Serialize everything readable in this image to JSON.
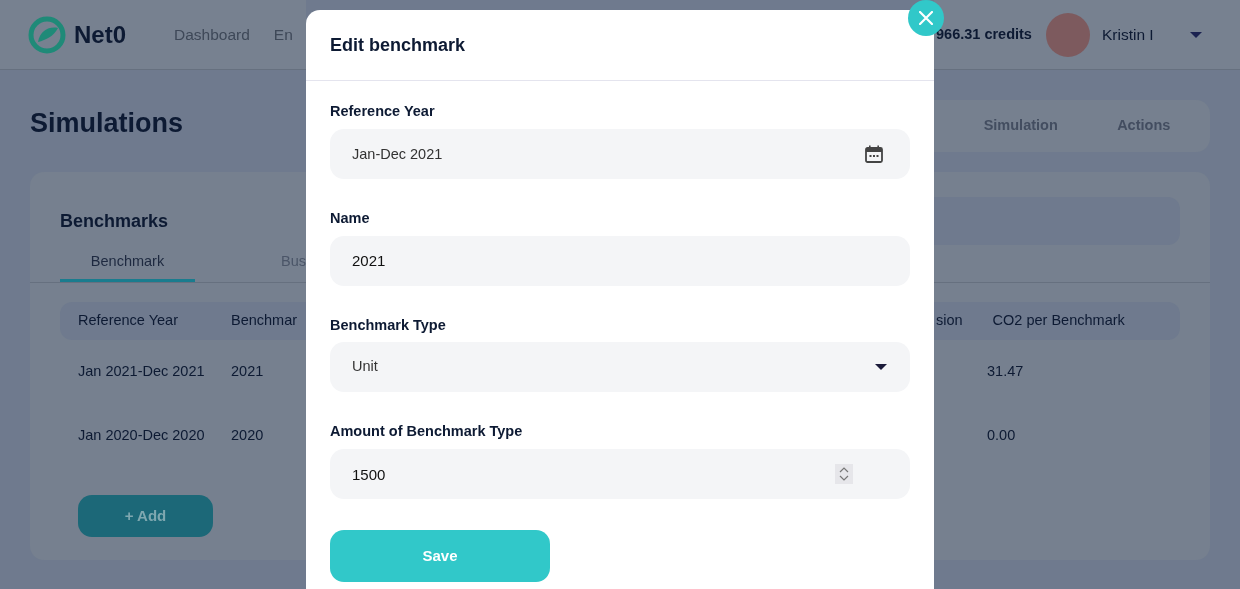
{
  "header": {
    "logo_text": "Net0",
    "nav": [
      {
        "label": "Dashboard"
      },
      {
        "label": "En"
      }
    ],
    "credits": "966.31 credits",
    "user": "Kristin I"
  },
  "page_title": "Simulations",
  "top_tabs": [
    {
      "label": "Simulation"
    },
    {
      "label": "Actions"
    }
  ],
  "benchmarks": {
    "title": "Benchmarks",
    "tabs": [
      {
        "label": "Benchmark",
        "selected": true
      },
      {
        "label": "Bus",
        "selected": false
      }
    ],
    "table": {
      "columns_left": [
        "Reference Year",
        "Benchmar"
      ],
      "columns_right": [
        "sion",
        "CO2 per Benchmark"
      ],
      "rows": [
        {
          "reference_year": "Jan 2021-Dec 2021",
          "benchmark": "2021",
          "co2_per_benchmark": "31.47"
        },
        {
          "reference_year": "Jan 2020-Dec 2020",
          "benchmark": "2020",
          "co2_per_benchmark": "0.00"
        }
      ]
    },
    "add_button": "+ Add"
  },
  "modal": {
    "title": "Edit benchmark",
    "fields": [
      {
        "kind": "date",
        "label": "Reference Year",
        "value": "Jan-Dec 2021"
      },
      {
        "kind": "text",
        "label": "Name",
        "value": "2021"
      },
      {
        "kind": "select",
        "label": "Benchmark Type",
        "value": "Unit"
      },
      {
        "kind": "number",
        "label": "Amount of Benchmark Type",
        "value": "1500"
      }
    ],
    "save_button": "Save"
  }
}
